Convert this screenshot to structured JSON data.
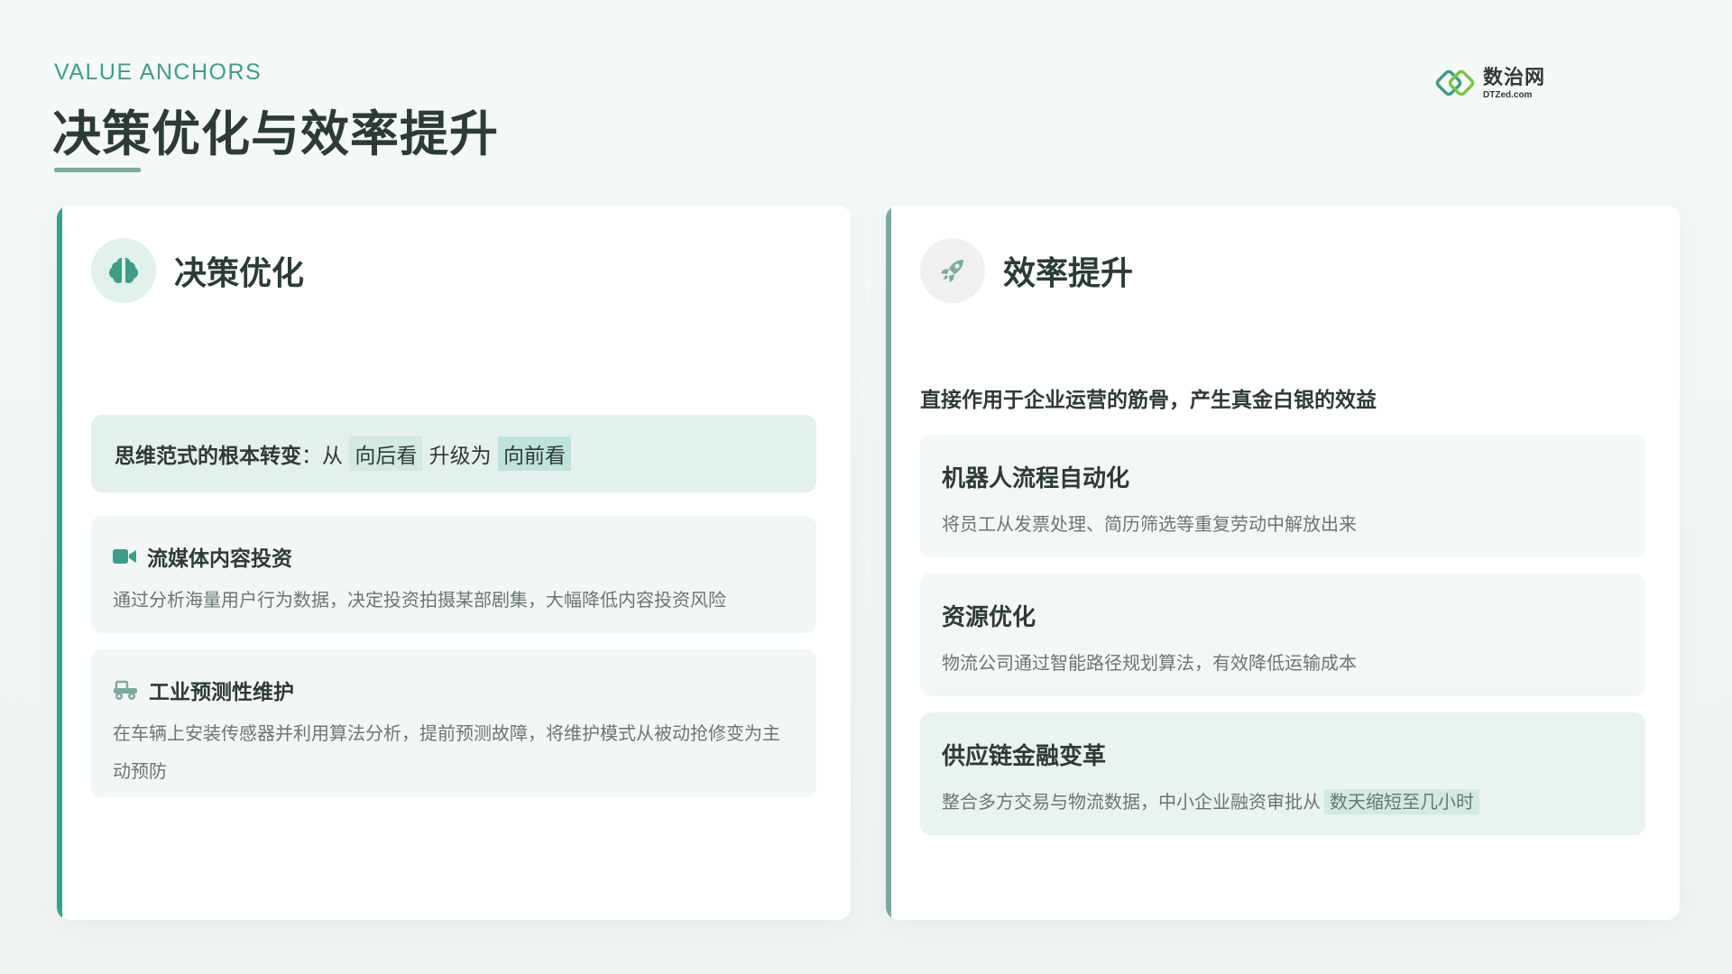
{
  "header": {
    "eyebrow": "VALUE ANCHORS",
    "title": "决策优化与效率提升"
  },
  "logo": {
    "cn": "数治网",
    "en": "DTZed.com"
  },
  "left_card": {
    "title": "决策优化",
    "icon": "brain-icon",
    "banner": {
      "lead": "思维范式的根本转变",
      "colon": "：",
      "from": "从",
      "old": "向后看",
      "mid": "升级为",
      "new": "向前看"
    },
    "items": [
      {
        "icon": "video-camera-icon",
        "title": "流媒体内容投资",
        "desc": "通过分析海量用户行为数据，决定投资拍摄某部剧集，大幅降低内容投资风险"
      },
      {
        "icon": "tractor-icon",
        "title": "工业预测性维护",
        "desc": "在车辆上安装传感器并利用算法分析，提前预测故障，将维护模式从被动抢修变为主动预防"
      }
    ]
  },
  "right_card": {
    "title": "效率提升",
    "icon": "rocket-icon",
    "intro": "直接作用于企业运营的筋骨，产生真金白银的效益",
    "items": [
      {
        "title": "机器人流程自动化",
        "desc": "将员工从发票处理、简历筛选等重复劳动中解放出来"
      },
      {
        "title": "资源优化",
        "desc": "物流公司通过智能路径规划算法，有效降低运输成本"
      },
      {
        "title": "供应链金融变革",
        "desc_prefix": "整合多方交易与物流数据，中小企业融资审批从",
        "desc_highlight": "数天缩短至几小时"
      }
    ]
  },
  "colors": {
    "accent": "#3f9d88",
    "accent_muted": "#7fa9a0",
    "title_text": "#2c3b37",
    "body_text": "#6b7673"
  }
}
